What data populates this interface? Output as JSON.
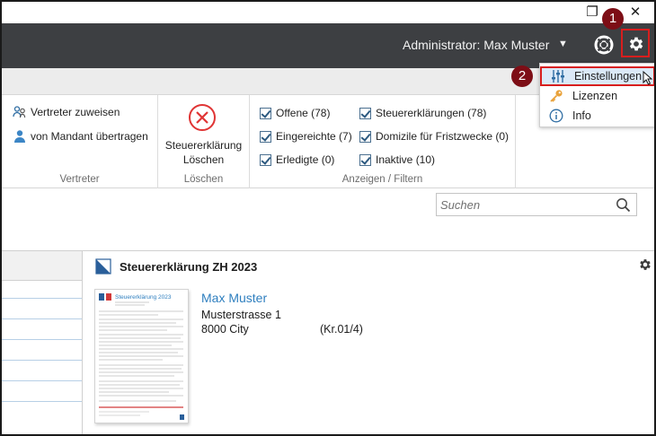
{
  "window": {
    "restore_glyph": "❐",
    "close_glyph": "✕"
  },
  "header": {
    "user_label": "Administrator: Max Muster",
    "caret": "▼",
    "icons": [
      "help-lifebuoy-icon",
      "gear-icon"
    ]
  },
  "callouts": {
    "one": "1",
    "two": "2",
    "color": "#7d0e16",
    "highlight_color": "#d81e1e"
  },
  "settings_menu": {
    "items": [
      {
        "label": "Einstellungen",
        "icon": "sliders-icon",
        "highlighted": true
      },
      {
        "label": "Lizenzen",
        "icon": "key-icon",
        "highlighted": false
      },
      {
        "label": "Info",
        "icon": "info-icon",
        "highlighted": false
      }
    ]
  },
  "ribbon": {
    "vertreter": {
      "assign_label": "Vertreter zuweisen",
      "transfer_label": "von Mandant übertragen",
      "group_label": "Vertreter"
    },
    "loeschen": {
      "button_line1": "Steuererklärung",
      "button_line2": "Löschen",
      "group_label": "Löschen"
    },
    "filter": {
      "col1": [
        {
          "label": "Offene (78)",
          "checked": true
        },
        {
          "label": "Eingereichte (7)",
          "checked": true
        },
        {
          "label": "Erledigte (0)",
          "checked": true
        }
      ],
      "col2": [
        {
          "label": "Steuererklärungen (78)",
          "checked": true
        },
        {
          "label": "Domizile für Fristzwecke (0)",
          "checked": true
        },
        {
          "label": "Inaktive (10)",
          "checked": true
        }
      ],
      "group_label": "Anzeigen / Filtern"
    }
  },
  "search": {
    "placeholder": "Suchen",
    "value": ""
  },
  "detail": {
    "title": "Steuererklärung ZH 2023",
    "thumbnail_heading": "Steuererklärung 2023",
    "client": {
      "name": "Max Muster",
      "street": "Musterstrasse 1",
      "city": "8000 City",
      "number": "(Kr.01/4)"
    }
  }
}
